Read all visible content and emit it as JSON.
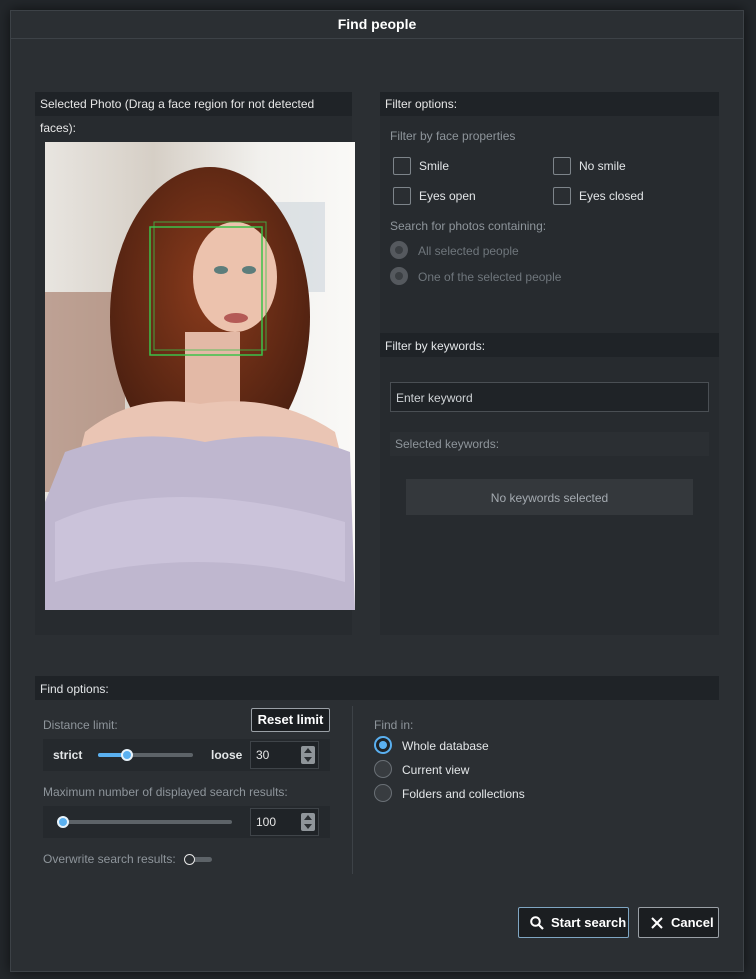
{
  "dialog": {
    "title": "Find people"
  },
  "photo_panel": {
    "header": "Selected Photo (Drag a face region for not detected faces):"
  },
  "filter_panel": {
    "header": "Filter options:",
    "face_props_label": "Filter by face properties",
    "checkboxes": {
      "smile": "Smile",
      "no_smile": "No smile",
      "eyes_open": "Eyes open",
      "eyes_closed": "Eyes closed"
    },
    "search_containing_label": "Search for photos containing:",
    "radio_all": "All selected people",
    "radio_one": "One of the selected people"
  },
  "keywords_panel": {
    "header": "Filter by keywords:",
    "input_placeholder": "Enter keyword",
    "selected_label": "Selected keywords:",
    "empty_text": "No keywords selected"
  },
  "find_options": {
    "header": "Find options:",
    "distance_label": "Distance limit:",
    "reset_button": "Reset limit",
    "strict_label": "strict",
    "loose_label": "loose",
    "distance_value": "30",
    "distance_slider_fraction": 0.3,
    "max_results_label": "Maximum number of displayed search results:",
    "max_results_value": "100",
    "max_slider_fraction": 0.0,
    "overwrite_label": "Overwrite search results:",
    "find_in_label": "Find in:",
    "find_in_options": [
      "Whole database",
      "Current view",
      "Folders and collections"
    ],
    "find_in_selected": "Whole database"
  },
  "footer": {
    "start_button": "Start search",
    "cancel_button": "Cancel"
  },
  "colors": {
    "accent": "#5ab0f0",
    "face_box": "#3cc24a"
  },
  "icons": {
    "start": "search-icon",
    "cancel": "close-icon"
  }
}
